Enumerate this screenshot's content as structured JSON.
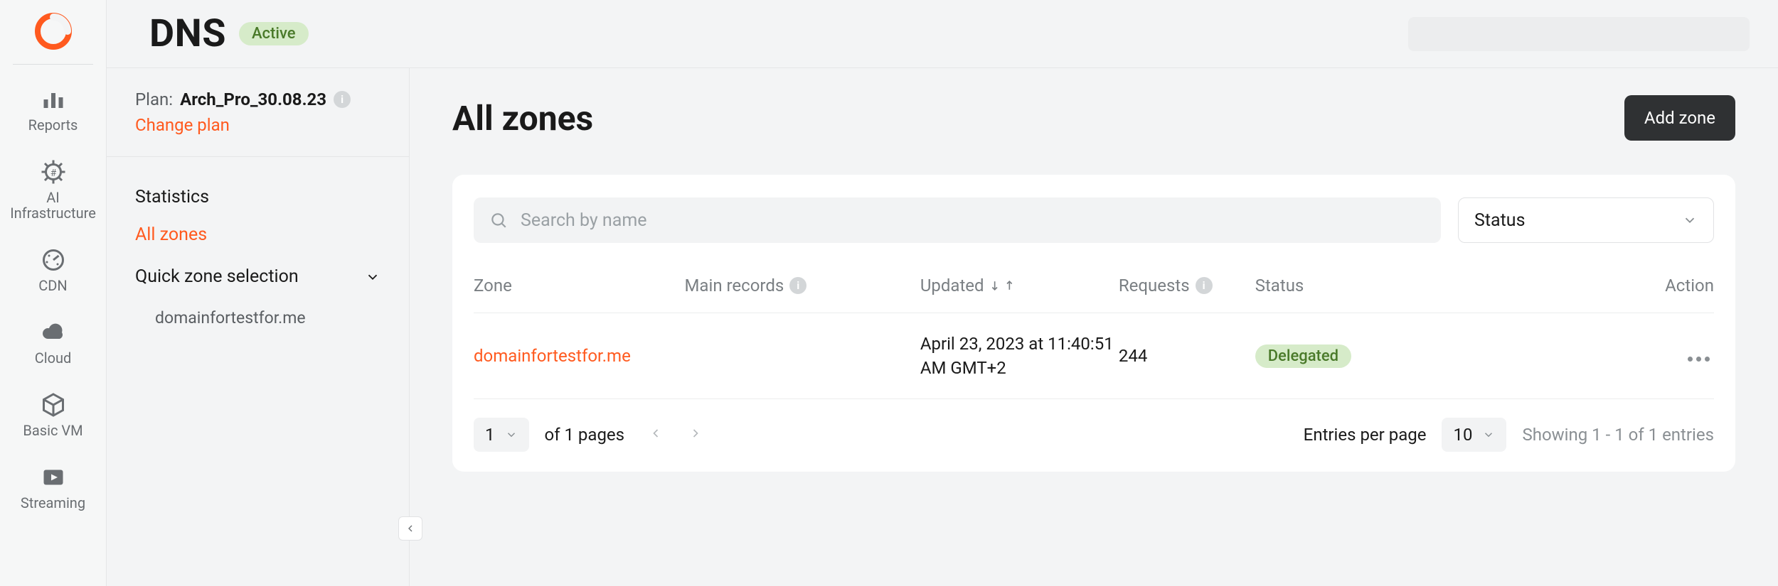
{
  "header": {
    "title": "DNS",
    "badge": "Active"
  },
  "globalNav": {
    "items": [
      {
        "label": "Reports"
      },
      {
        "label": "AI Infrastructure"
      },
      {
        "label": "CDN"
      },
      {
        "label": "Cloud"
      },
      {
        "label": "Basic VM"
      },
      {
        "label": "Streaming"
      }
    ]
  },
  "sectionNav": {
    "planLabel": "Plan:",
    "planName": "Arch_Pro_30.08.23",
    "changePlan": "Change plan",
    "statistics": "Statistics",
    "allZones": "All zones",
    "quickZone": "Quick zone selection",
    "quickZoneItems": [
      {
        "label": "domainfortestfor.me"
      }
    ]
  },
  "main": {
    "title": "All zones",
    "addZone": "Add zone",
    "search": {
      "placeholder": "Search by name"
    },
    "statusFilter": {
      "label": "Status"
    },
    "columns": {
      "zone": "Zone",
      "mainRecords": "Main records",
      "updated": "Updated",
      "requests": "Requests",
      "status": "Status",
      "action": "Action"
    },
    "rows": [
      {
        "zone": "domainfortestfor.me",
        "mainRecords": "",
        "updated": "April 23, 2023 at 11:40:51\nAM GMT+2",
        "requests": "244",
        "status": "Delegated"
      }
    ],
    "pagination": {
      "page": "1",
      "ofPages": "of 1 pages",
      "entriesLabel": "Entries per page",
      "perPage": "10",
      "showing": "Showing 1 - 1 of 1 entries"
    }
  }
}
